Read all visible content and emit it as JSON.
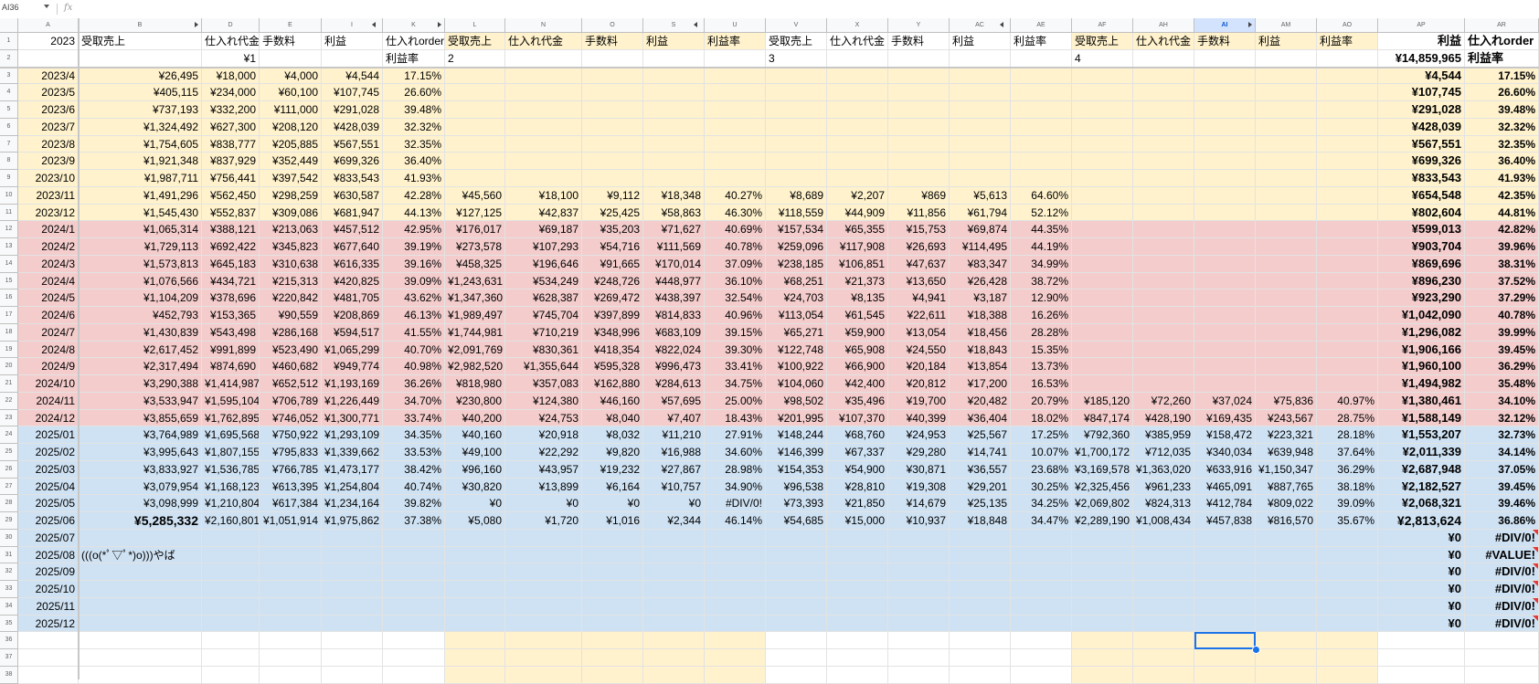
{
  "formula_bar": {
    "name_box": "AI36",
    "fx_label": "fx",
    "value": ""
  },
  "columns": [
    "A",
    "B",
    "D",
    "E",
    "I",
    "K",
    "L",
    "N",
    "O",
    "S",
    "U",
    "V",
    "X",
    "Y",
    "AC",
    "AE",
    "AF",
    "AH",
    "AI",
    "AM",
    "AO",
    "AP",
    "AR"
  ],
  "active_column": "AI",
  "active_cell": "AI36",
  "colors": {
    "yellow": "#fff2cc",
    "pink": "#f4cccc",
    "blue": "#cfe2f3",
    "white": "#ffffff",
    "selection": "#1a73e8",
    "note_marker": "#e53935"
  },
  "header_rows": {
    "1": {
      "A": "2023",
      "B": "受取売上",
      "D": "仕入れ代金",
      "E": "手数料",
      "I": "利益",
      "K": "仕入れorder",
      "L": "受取売上",
      "N": "仕入れ代金",
      "O": "手数料",
      "S": "利益",
      "U": "利益率",
      "V": "受取売上",
      "X": "仕入れ代金",
      "Y": "手数料",
      "AC": "利益",
      "AE": "利益率",
      "AF": "受取売上",
      "AH": "仕入れ代金",
      "AI": "手数料",
      "AM": "利益",
      "AO": "利益率",
      "AP": "利益",
      "AR": "仕入れorder"
    },
    "2": {
      "D": "¥1",
      "K": "利益率",
      "L": "2",
      "V": "3",
      "AF": "4",
      "AP": "¥14,859,965",
      "AR": "利益率"
    }
  },
  "data_rows": [
    {
      "row": 3,
      "band": "yellow",
      "A": "2023/4",
      "B": "¥26,495",
      "D": "¥18,000",
      "E": "¥4,000",
      "I": "¥4,544",
      "K": "17.15%",
      "AP": "¥4,544",
      "AR": "17.15%"
    },
    {
      "row": 4,
      "band": "yellow",
      "A": "2023/5",
      "B": "¥405,115",
      "D": "¥234,000",
      "E": "¥60,100",
      "I": "¥107,745",
      "K": "26.60%",
      "AP": "¥107,745",
      "AR": "26.60%"
    },
    {
      "row": 5,
      "band": "yellow",
      "A": "2023/6",
      "B": "¥737,193",
      "D": "¥332,200",
      "E": "¥111,000",
      "I": "¥291,028",
      "K": "39.48%",
      "AP": "¥291,028",
      "AR": "39.48%"
    },
    {
      "row": 6,
      "band": "yellow",
      "A": "2023/7",
      "B": "¥1,324,492",
      "D": "¥627,300",
      "E": "¥208,120",
      "I": "¥428,039",
      "K": "32.32%",
      "AP": "¥428,039",
      "AR": "32.32%"
    },
    {
      "row": 7,
      "band": "yellow",
      "A": "2023/8",
      "B": "¥1,754,605",
      "D": "¥838,777",
      "E": "¥205,885",
      "I": "¥567,551",
      "K": "32.35%",
      "AP": "¥567,551",
      "AR": "32.35%"
    },
    {
      "row": 8,
      "band": "yellow",
      "A": "2023/9",
      "B": "¥1,921,348",
      "D": "¥837,929",
      "E": "¥352,449",
      "I": "¥699,326",
      "K": "36.40%",
      "AP": "¥699,326",
      "AR": "36.40%"
    },
    {
      "row": 9,
      "band": "yellow",
      "A": "2023/10",
      "B": "¥1,987,711",
      "D": "¥756,441",
      "E": "¥397,542",
      "I": "¥833,543",
      "K": "41.93%",
      "AP": "¥833,543",
      "AR": "41.93%"
    },
    {
      "row": 10,
      "band": "yellow",
      "A": "2023/11",
      "B": "¥1,491,296",
      "D": "¥562,450",
      "E": "¥298,259",
      "I": "¥630,587",
      "K": "42.28%",
      "L": "¥45,560",
      "N": "¥18,100",
      "O": "¥9,112",
      "S": "¥18,348",
      "U": "40.27%",
      "V": "¥8,689",
      "X": "¥2,207",
      "Y": "¥869",
      "AC": "¥5,613",
      "AE": "64.60%",
      "AP": "¥654,548",
      "AR": "42.35%"
    },
    {
      "row": 11,
      "band": "yellow",
      "A": "2023/12",
      "B": "¥1,545,430",
      "D": "¥552,837",
      "E": "¥309,086",
      "I": "¥681,947",
      "K": "44.13%",
      "L": "¥127,125",
      "N": "¥42,837",
      "O": "¥25,425",
      "S": "¥58,863",
      "U": "46.30%",
      "V": "¥118,559",
      "X": "¥44,909",
      "Y": "¥11,856",
      "AC": "¥61,794",
      "AE": "52.12%",
      "AP": "¥802,604",
      "AR": "44.81%"
    },
    {
      "row": 12,
      "band": "pink",
      "A": "2024/1",
      "B": "¥1,065,314",
      "D": "¥388,121",
      "E": "¥213,063",
      "I": "¥457,512",
      "K": "42.95%",
      "L": "¥176,017",
      "N": "¥69,187",
      "O": "¥35,203",
      "S": "¥71,627",
      "U": "40.69%",
      "V": "¥157,534",
      "X": "¥65,355",
      "Y": "¥15,753",
      "AC": "¥69,874",
      "AE": "44.35%",
      "AP": "¥599,013",
      "AR": "42.82%"
    },
    {
      "row": 13,
      "band": "pink",
      "A": "2024/2",
      "B": "¥1,729,113",
      "D": "¥692,422",
      "E": "¥345,823",
      "I": "¥677,640",
      "K": "39.19%",
      "L": "¥273,578",
      "N": "¥107,293",
      "O": "¥54,716",
      "S": "¥111,569",
      "U": "40.78%",
      "V": "¥259,096",
      "X": "¥117,908",
      "Y": "¥26,693",
      "AC": "¥114,495",
      "AE": "44.19%",
      "AP": "¥903,704",
      "AR": "39.96%"
    },
    {
      "row": 14,
      "band": "pink",
      "A": "2024/3",
      "B": "¥1,573,813",
      "D": "¥645,183",
      "E": "¥310,638",
      "I": "¥616,335",
      "K": "39.16%",
      "L": "¥458,325",
      "N": "¥196,646",
      "O": "¥91,665",
      "S": "¥170,014",
      "U": "37.09%",
      "V": "¥238,185",
      "X": "¥106,851",
      "Y": "¥47,637",
      "AC": "¥83,347",
      "AE": "34.99%",
      "AP": "¥869,696",
      "AR": "38.31%"
    },
    {
      "row": 15,
      "band": "pink",
      "A": "2024/4",
      "B": "¥1,076,566",
      "D": "¥434,721",
      "E": "¥215,313",
      "I": "¥420,825",
      "K": "39.09%",
      "L": "¥1,243,631",
      "N": "¥534,249",
      "O": "¥248,726",
      "S": "¥448,977",
      "U": "36.10%",
      "V": "¥68,251",
      "X": "¥21,373",
      "Y": "¥13,650",
      "AC": "¥26,428",
      "AE": "38.72%",
      "AP": "¥896,230",
      "AR": "37.52%"
    },
    {
      "row": 16,
      "band": "pink",
      "A": "2024/5",
      "B": "¥1,104,209",
      "D": "¥378,696",
      "E": "¥220,842",
      "I": "¥481,705",
      "K": "43.62%",
      "L": "¥1,347,360",
      "N": "¥628,387",
      "O": "¥269,472",
      "S": "¥438,397",
      "U": "32.54%",
      "V": "¥24,703",
      "X": "¥8,135",
      "Y": "¥4,941",
      "AC": "¥3,187",
      "AE": "12.90%",
      "AP": "¥923,290",
      "AR": "37.29%"
    },
    {
      "row": 17,
      "band": "pink",
      "A": "2024/6",
      "B": "¥452,793",
      "D": "¥153,365",
      "E": "¥90,559",
      "I": "¥208,869",
      "K": "46.13%",
      "L": "¥1,989,497",
      "N": "¥745,704",
      "O": "¥397,899",
      "S": "¥814,833",
      "U": "40.96%",
      "V": "¥113,054",
      "X": "¥61,545",
      "Y": "¥22,611",
      "AC": "¥18,388",
      "AE": "16.26%",
      "AP": "¥1,042,090",
      "AR": "40.78%"
    },
    {
      "row": 18,
      "band": "pink",
      "A": "2024/7",
      "B": "¥1,430,839",
      "D": "¥543,498",
      "E": "¥286,168",
      "I": "¥594,517",
      "K": "41.55%",
      "L": "¥1,744,981",
      "N": "¥710,219",
      "O": "¥348,996",
      "S": "¥683,109",
      "U": "39.15%",
      "V": "¥65,271",
      "X": "¥59,900",
      "Y": "¥13,054",
      "AC": "¥18,456",
      "AE": "28.28%",
      "AP": "¥1,296,082",
      "AR": "39.99%"
    },
    {
      "row": 19,
      "band": "pink",
      "A": "2024/8",
      "B": "¥2,617,452",
      "D": "¥991,899",
      "E": "¥523,490",
      "I": "¥1,065,299",
      "K": "40.70%",
      "L": "¥2,091,769",
      "N": "¥830,361",
      "O": "¥418,354",
      "S": "¥822,024",
      "U": "39.30%",
      "V": "¥122,748",
      "X": "¥65,908",
      "Y": "¥24,550",
      "AC": "¥18,843",
      "AE": "15.35%",
      "AP": "¥1,906,166",
      "AR": "39.45%"
    },
    {
      "row": 20,
      "band": "pink",
      "A": "2024/9",
      "B": "¥2,317,494",
      "D": "¥874,690",
      "E": "¥460,682",
      "I": "¥949,774",
      "K": "40.98%",
      "L": "¥2,982,520",
      "N": "¥1,355,644",
      "O": "¥595,328",
      "S": "¥996,473",
      "U": "33.41%",
      "V": "¥100,922",
      "X": "¥66,900",
      "Y": "¥20,184",
      "AC": "¥13,854",
      "AE": "13.73%",
      "AP": "¥1,960,100",
      "AR": "36.29%"
    },
    {
      "row": 21,
      "band": "pink",
      "A": "2024/10",
      "B": "¥3,290,388",
      "D": "¥1,414,987",
      "E": "¥652,512",
      "I": "¥1,193,169",
      "K": "36.26%",
      "L": "¥818,980",
      "N": "¥357,083",
      "O": "¥162,880",
      "S": "¥284,613",
      "U": "34.75%",
      "V": "¥104,060",
      "X": "¥42,400",
      "Y": "¥20,812",
      "AC": "¥17,200",
      "AE": "16.53%",
      "AP": "¥1,494,982",
      "AR": "35.48%"
    },
    {
      "row": 22,
      "band": "pink",
      "A": "2024/11",
      "B": "¥3,533,947",
      "D": "¥1,595,104",
      "E": "¥706,789",
      "I": "¥1,226,449",
      "K": "34.70%",
      "L": "¥230,800",
      "N": "¥124,380",
      "O": "¥46,160",
      "S": "¥57,695",
      "U": "25.00%",
      "V": "¥98,502",
      "X": "¥35,496",
      "Y": "¥19,700",
      "AC": "¥20,482",
      "AE": "20.79%",
      "AF": "¥185,120",
      "AH": "¥72,260",
      "AI": "¥37,024",
      "AM": "¥75,836",
      "AO": "40.97%",
      "AP": "¥1,380,461",
      "AR": "34.10%"
    },
    {
      "row": 23,
      "band": "pink",
      "A": "2024/12",
      "B": "¥3,855,659",
      "D": "¥1,762,895",
      "E": "¥746,052",
      "I": "¥1,300,771",
      "K": "33.74%",
      "L": "¥40,200",
      "N": "¥24,753",
      "O": "¥8,040",
      "S": "¥7,407",
      "U": "18.43%",
      "V": "¥201,995",
      "X": "¥107,370",
      "Y": "¥40,399",
      "AC": "¥36,404",
      "AE": "18.02%",
      "AF": "¥847,174",
      "AH": "¥428,190",
      "AI": "¥169,435",
      "AM": "¥243,567",
      "AO": "28.75%",
      "AP": "¥1,588,149",
      "AR": "32.12%"
    },
    {
      "row": 24,
      "band": "blue",
      "A": "2025/01",
      "B": "¥3,764,989",
      "D": "¥1,695,568",
      "E": "¥750,922",
      "I": "¥1,293,109",
      "K": "34.35%",
      "L": "¥40,160",
      "N": "¥20,918",
      "O": "¥8,032",
      "S": "¥11,210",
      "U": "27.91%",
      "V": "¥148,244",
      "X": "¥68,760",
      "Y": "¥24,953",
      "AC": "¥25,567",
      "AE": "17.25%",
      "AF": "¥792,360",
      "AH": "¥385,959",
      "AI": "¥158,472",
      "AM": "¥223,321",
      "AO": "28.18%",
      "AP": "¥1,553,207",
      "AR": "32.73%"
    },
    {
      "row": 25,
      "band": "blue",
      "A": "2025/02",
      "B": "¥3,995,643",
      "D": "¥1,807,155",
      "E": "¥795,833",
      "I": "¥1,339,662",
      "K": "33.53%",
      "L": "¥49,100",
      "N": "¥22,292",
      "O": "¥9,820",
      "S": "¥16,988",
      "U": "34.60%",
      "V": "¥146,399",
      "X": "¥67,337",
      "Y": "¥29,280",
      "AC": "¥14,741",
      "AE": "10.07%",
      "AF": "¥1,700,172",
      "AH": "¥712,035",
      "AI": "¥340,034",
      "AM": "¥639,948",
      "AO": "37.64%",
      "AP": "¥2,011,339",
      "AR": "34.14%"
    },
    {
      "row": 26,
      "band": "blue",
      "A": "2025/03",
      "B": "¥3,833,927",
      "D": "¥1,536,785",
      "E": "¥766,785",
      "I": "¥1,473,177",
      "K": "38.42%",
      "L": "¥96,160",
      "N": "¥43,957",
      "O": "¥19,232",
      "S": "¥27,867",
      "U": "28.98%",
      "V": "¥154,353",
      "X": "¥54,900",
      "Y": "¥30,871",
      "AC": "¥36,557",
      "AE": "23.68%",
      "AF": "¥3,169,578",
      "AH": "¥1,363,020",
      "AI": "¥633,916",
      "AM": "¥1,150,347",
      "AO": "36.29%",
      "AP": "¥2,687,948",
      "AR": "37.05%"
    },
    {
      "row": 27,
      "band": "blue",
      "A": "2025/04",
      "B": "¥3,079,954",
      "D": "¥1,168,123",
      "E": "¥613,395",
      "I": "¥1,254,804",
      "K": "40.74%",
      "L": "¥30,820",
      "N": "¥13,899",
      "O": "¥6,164",
      "S": "¥10,757",
      "U": "34.90%",
      "V": "¥96,538",
      "X": "¥28,810",
      "Y": "¥19,308",
      "AC": "¥29,201",
      "AE": "30.25%",
      "AF": "¥2,325,456",
      "AH": "¥961,233",
      "AI": "¥465,091",
      "AM": "¥887,765",
      "AO": "38.18%",
      "AP": "¥2,182,527",
      "AR": "39.45%"
    },
    {
      "row": 28,
      "band": "blue",
      "A": "2025/05",
      "B": "¥3,098,999",
      "D": "¥1,210,804",
      "E": "¥617,384",
      "I": "¥1,234,164",
      "K": "39.82%",
      "L": "¥0",
      "N": "¥0",
      "O": "¥0",
      "S": "¥0",
      "U": "#DIV/0!",
      "V": "¥73,393",
      "X": "¥21,850",
      "Y": "¥14,679",
      "AC": "¥25,135",
      "AE": "34.25%",
      "AF": "¥2,069,802",
      "AH": "¥824,313",
      "AI": "¥412,784",
      "AM": "¥809,022",
      "AO": "39.09%",
      "AP": "¥2,068,321",
      "AR": "39.46%"
    },
    {
      "row": 29,
      "band": "blue",
      "A": "2025/06",
      "B": "¥5,285,332",
      "D": "¥2,160,801",
      "E": "¥1,051,914",
      "I": "¥1,975,862",
      "K": "37.38%",
      "L": "¥5,080",
      "N": "¥1,720",
      "O": "¥1,016",
      "S": "¥2,344",
      "U": "46.14%",
      "V": "¥54,685",
      "X": "¥15,000",
      "Y": "¥10,937",
      "AC": "¥18,848",
      "AE": "34.47%",
      "AF": "¥2,289,190",
      "AH": "¥1,008,434",
      "AI": "¥457,838",
      "AM": "¥816,570",
      "AO": "35.67%",
      "AP": "¥2,813,624",
      "AR": "36.86%"
    },
    {
      "row": 30,
      "band": "blue",
      "A": "2025/07",
      "AP": "¥0",
      "AR": "#DIV/0!"
    },
    {
      "row": 31,
      "band": "blue",
      "A": "2025/08",
      "B": "(((o(*ﾟ▽ﾟ*)o)))やば",
      "AP": "¥0",
      "AR": "#VALUE!"
    },
    {
      "row": 32,
      "band": "blue",
      "A": "2025/09",
      "AP": "¥0",
      "AR": "#DIV/0!"
    },
    {
      "row": 33,
      "band": "blue",
      "A": "2025/10",
      "AP": "¥0",
      "AR": "#DIV/0!"
    },
    {
      "row": 34,
      "band": "blue",
      "A": "2025/11",
      "AP": "¥0",
      "AR": "#DIV/0!"
    },
    {
      "row": 35,
      "band": "blue",
      "A": "2025/12",
      "AP": "¥0",
      "AR": "#DIV/0!"
    },
    {
      "row": 36,
      "band": "empty"
    },
    {
      "row": 37,
      "band": "empty"
    },
    {
      "row": 38,
      "band": "empty"
    }
  ]
}
